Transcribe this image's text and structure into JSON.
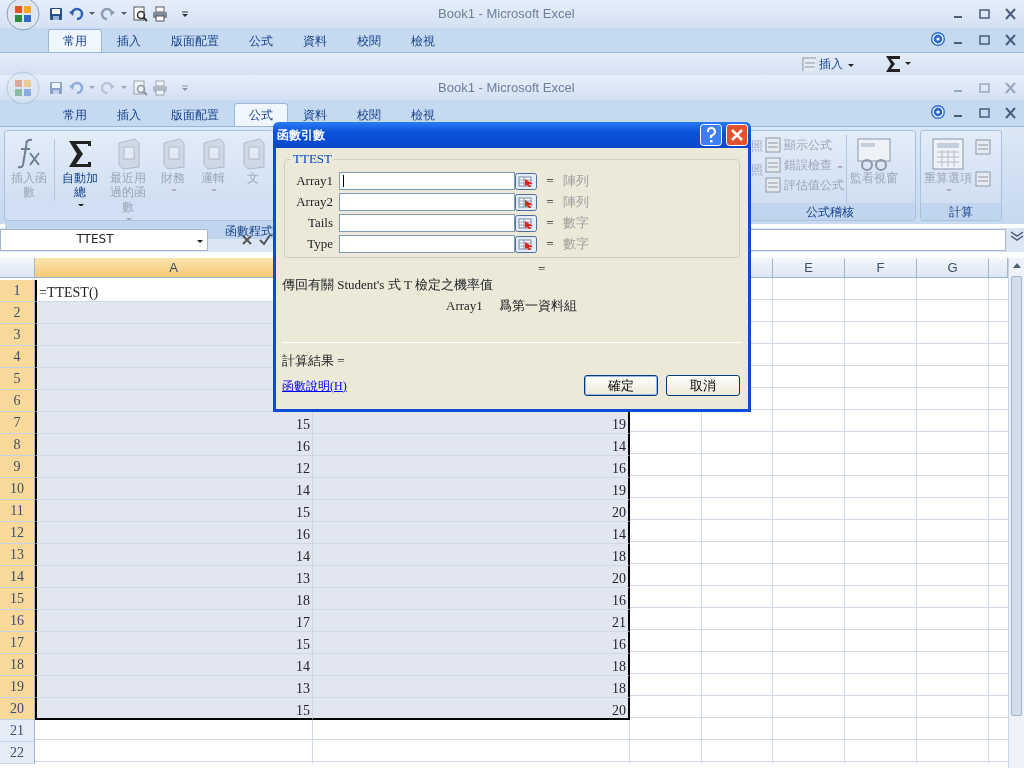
{
  "back_window": {
    "title": "Book1 - Microsoft Excel",
    "tabs": [
      {
        "label": "常用",
        "selected": true
      },
      {
        "label": "插入",
        "selected": false
      },
      {
        "label": "版面配置",
        "selected": false
      },
      {
        "label": "公式",
        "selected": false
      },
      {
        "label": "資料",
        "selected": false
      },
      {
        "label": "校閱",
        "selected": false
      },
      {
        "label": "檢視",
        "selected": false
      }
    ],
    "ribbon_button": "插入"
  },
  "window": {
    "title": "Book1 - Microsoft Excel",
    "tabs": [
      {
        "label": "常用",
        "selected": false
      },
      {
        "label": "插入",
        "selected": false
      },
      {
        "label": "版面配置",
        "selected": false
      },
      {
        "label": "公式",
        "selected": true
      },
      {
        "label": "資料",
        "selected": false
      },
      {
        "label": "校閱",
        "selected": false
      },
      {
        "label": "檢視",
        "selected": false
      }
    ],
    "ribbon": {
      "function_library": {
        "label": "函數程式",
        "buttons": [
          {
            "label": "插入函數",
            "kind": "fx",
            "disabled": true,
            "dropdown": false
          },
          {
            "label": "自動加總",
            "kind": "sigma",
            "disabled": false,
            "dropdown": true
          },
          {
            "label": "最近用過的函數",
            "kind": "book",
            "disabled": true,
            "dropdown": true
          },
          {
            "label": "財務",
            "kind": "book",
            "disabled": true,
            "dropdown": true
          },
          {
            "label": "邏輯",
            "kind": "book",
            "disabled": true,
            "dropdown": true
          },
          {
            "label": "文",
            "kind": "book",
            "disabled": true,
            "dropdown": false
          }
        ]
      },
      "auditing": {
        "label": "公式稽核",
        "partial_labels": [
          "照",
          "照"
        ],
        "small_buttons": [
          {
            "label": "顯示公式",
            "dropdown": false
          },
          {
            "label": "錯誤檢查",
            "dropdown": true
          },
          {
            "label": "評估值公式",
            "dropdown": false
          }
        ],
        "watch_button": "監看視窗"
      },
      "calculation": {
        "label": "計算",
        "button": "重算選項"
      }
    },
    "name_box": "TTEST",
    "column_headers": [
      {
        "label": "A",
        "selected": true
      },
      {
        "label": "E",
        "selected": false
      },
      {
        "label": "F",
        "selected": false
      },
      {
        "label": "G",
        "selected": false
      }
    ],
    "rows": [
      {
        "header": "1",
        "selected": true,
        "active": true,
        "a": "=TTEST()"
      },
      {
        "header": "2",
        "selected": true
      },
      {
        "header": "3",
        "selected": true
      },
      {
        "header": "4",
        "selected": true
      },
      {
        "header": "5",
        "selected": true
      },
      {
        "header": "6",
        "selected": true
      },
      {
        "header": "7",
        "selected": true,
        "a": "15",
        "b": "19"
      },
      {
        "header": "8",
        "selected": true,
        "a": "16",
        "b": "14"
      },
      {
        "header": "9",
        "selected": true,
        "a": "12",
        "b": "16"
      },
      {
        "header": "10",
        "selected": true,
        "a": "14",
        "b": "19"
      },
      {
        "header": "11",
        "selected": true,
        "a": "15",
        "b": "20"
      },
      {
        "header": "12",
        "selected": true,
        "a": "16",
        "b": "14"
      },
      {
        "header": "13",
        "selected": true,
        "a": "14",
        "b": "18"
      },
      {
        "header": "14",
        "selected": true,
        "a": "13",
        "b": "20"
      },
      {
        "header": "15",
        "selected": true,
        "a": "18",
        "b": "16"
      },
      {
        "header": "16",
        "selected": true,
        "a": "17",
        "b": "21"
      },
      {
        "header": "17",
        "selected": true,
        "a": "15",
        "b": "16"
      },
      {
        "header": "18",
        "selected": true,
        "a": "14",
        "b": "18"
      },
      {
        "header": "19",
        "selected": true,
        "a": "13",
        "b": "18"
      },
      {
        "header": "20",
        "selected": true,
        "a": "15",
        "b": "20"
      },
      {
        "header": "21",
        "selected": false
      },
      {
        "header": "22",
        "selected": false
      }
    ]
  },
  "dialog": {
    "title": "函數引數",
    "function_name": "TTEST",
    "arguments": [
      {
        "label": "Array1",
        "equals": "=",
        "hint": "陣列",
        "focused": true
      },
      {
        "label": "Array2",
        "equals": "=",
        "hint": "陣列",
        "focused": false
      },
      {
        "label": "Tails",
        "equals": "=",
        "hint": "數字",
        "focused": false
      },
      {
        "label": "Type",
        "equals": "=",
        "hint": "數字",
        "focused": false
      }
    ],
    "result_equals": "=",
    "description": "傳回有關 Student's 式 T 檢定之機率值",
    "argument_help": {
      "name": "Array1",
      "text": "爲第一資料組"
    },
    "result_label": "計算結果 =",
    "help_link": "函數說明(H)",
    "buttons": [
      {
        "label": "確定",
        "default": true
      },
      {
        "label": "取消",
        "default": false
      }
    ]
  }
}
